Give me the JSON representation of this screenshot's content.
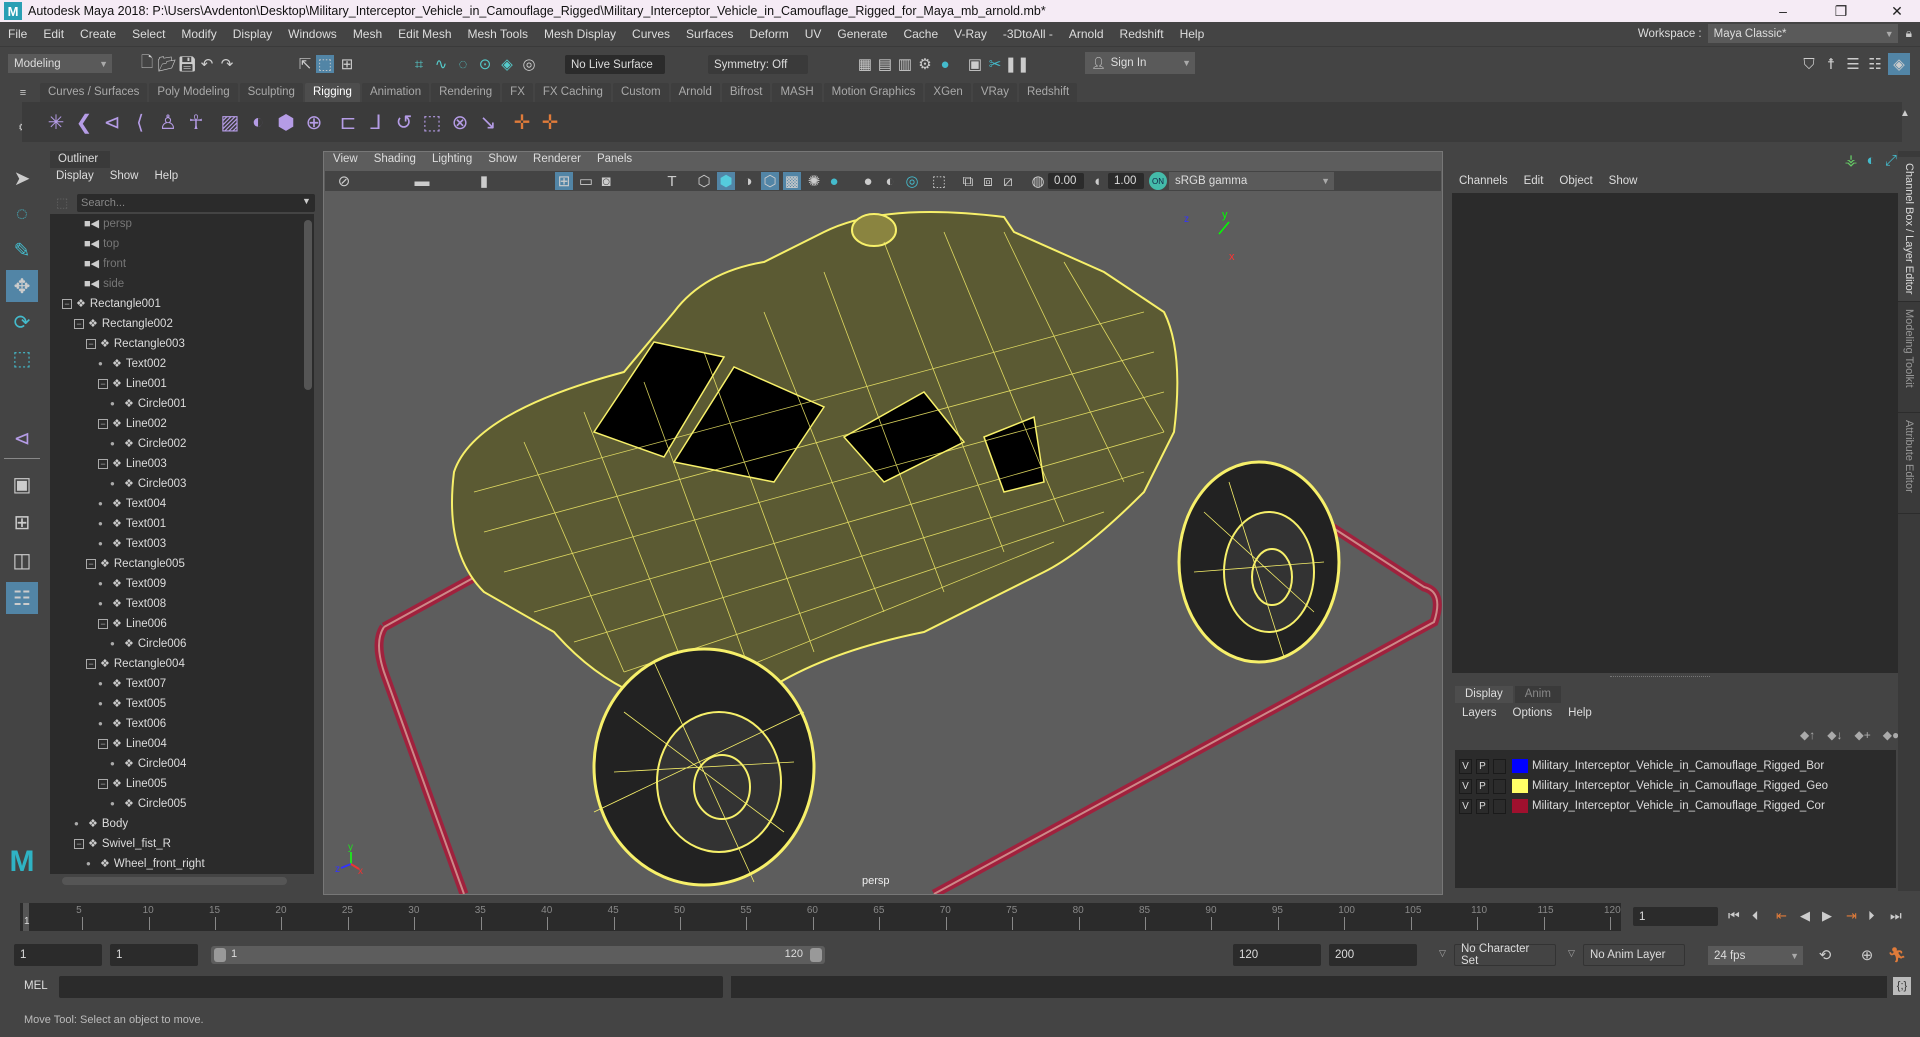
{
  "window": {
    "title": "Autodesk Maya 2018: P:\\Users\\Avdenton\\Desktop\\Military_Interceptor_Vehicle_in_Camouflage_Rigged\\Military_Interceptor_Vehicle_in_Camouflage_Rigged_for_Maya_mb_arnold.mb*",
    "logo": "M",
    "minimize": "–",
    "restore": "❐",
    "close": "✕"
  },
  "menubar": {
    "items": [
      "File",
      "Edit",
      "Create",
      "Select",
      "Modify",
      "Display",
      "Windows",
      "Mesh",
      "Edit Mesh",
      "Mesh Tools",
      "Mesh Display",
      "Curves",
      "Surfaces",
      "Deform",
      "UV",
      "Generate",
      "Cache",
      "V-Ray",
      "-3DtoAll -",
      "Arnold",
      "Redshift",
      "Help"
    ],
    "workspace_label": "Workspace :",
    "workspace_value": "Maya Classic*"
  },
  "statusline": {
    "mode": "Modeling",
    "live_surface": "No Live Surface",
    "symmetry": "Symmetry: Off",
    "sign_in": "Sign In"
  },
  "shelf": {
    "tabs": [
      "Curves / Surfaces",
      "Poly Modeling",
      "Sculpting",
      "Rigging",
      "Animation",
      "Rendering",
      "FX",
      "FX Caching",
      "Custom",
      "Arnold",
      "Bifrost",
      "MASH",
      "Motion Graphics",
      "XGen",
      "VRay",
      "Redshift"
    ],
    "active_tab": "Rigging"
  },
  "outliner": {
    "tab": "Outliner",
    "menu": [
      "Display",
      "Show",
      "Help"
    ],
    "search_placeholder": "Search...",
    "items": [
      {
        "name": "persp",
        "depth": 0,
        "type": "camera"
      },
      {
        "name": "top",
        "depth": 0,
        "type": "camera"
      },
      {
        "name": "front",
        "depth": 0,
        "type": "camera"
      },
      {
        "name": "side",
        "depth": 0,
        "type": "camera"
      },
      {
        "name": "Rectangle001",
        "depth": 0,
        "type": "group",
        "expanded": true
      },
      {
        "name": "Rectangle002",
        "depth": 1,
        "type": "group",
        "expanded": true
      },
      {
        "name": "Rectangle003",
        "depth": 2,
        "type": "group",
        "expanded": true
      },
      {
        "name": "Text002",
        "depth": 3,
        "type": "node"
      },
      {
        "name": "Line001",
        "depth": 3,
        "type": "group",
        "expanded": true
      },
      {
        "name": "Circle001",
        "depth": 4,
        "type": "node"
      },
      {
        "name": "Line002",
        "depth": 3,
        "type": "group",
        "expanded": true
      },
      {
        "name": "Circle002",
        "depth": 4,
        "type": "node"
      },
      {
        "name": "Line003",
        "depth": 3,
        "type": "group",
        "expanded": true
      },
      {
        "name": "Circle003",
        "depth": 4,
        "type": "node"
      },
      {
        "name": "Text004",
        "depth": 3,
        "type": "node"
      },
      {
        "name": "Text001",
        "depth": 3,
        "type": "node"
      },
      {
        "name": "Text003",
        "depth": 3,
        "type": "node"
      },
      {
        "name": "Rectangle005",
        "depth": 2,
        "type": "group",
        "expanded": true
      },
      {
        "name": "Text009",
        "depth": 3,
        "type": "node"
      },
      {
        "name": "Text008",
        "depth": 3,
        "type": "node"
      },
      {
        "name": "Line006",
        "depth": 3,
        "type": "group",
        "expanded": true
      },
      {
        "name": "Circle006",
        "depth": 4,
        "type": "node"
      },
      {
        "name": "Rectangle004",
        "depth": 2,
        "type": "group",
        "expanded": true
      },
      {
        "name": "Text007",
        "depth": 3,
        "type": "node"
      },
      {
        "name": "Text005",
        "depth": 3,
        "type": "node"
      },
      {
        "name": "Text006",
        "depth": 3,
        "type": "node"
      },
      {
        "name": "Line004",
        "depth": 3,
        "type": "group",
        "expanded": true
      },
      {
        "name": "Circle004",
        "depth": 4,
        "type": "node"
      },
      {
        "name": "Line005",
        "depth": 3,
        "type": "group",
        "expanded": true
      },
      {
        "name": "Circle005",
        "depth": 4,
        "type": "node"
      },
      {
        "name": "Body",
        "depth": 1,
        "type": "node"
      },
      {
        "name": "Swivel_fist_R",
        "depth": 1,
        "type": "group",
        "expanded": true
      },
      {
        "name": "Wheel_front_right",
        "depth": 2,
        "type": "node"
      }
    ]
  },
  "viewport": {
    "menu": [
      "View",
      "Shading",
      "Lighting",
      "Show",
      "Renderer",
      "Panels"
    ],
    "exposure": "0.00",
    "gamma": "1.00",
    "color_space": "sRGB gamma",
    "camera_label": "persp",
    "axis": {
      "x": "x",
      "y": "y",
      "z": "z"
    },
    "wire_color": "#f7f06a",
    "grid_color": "#a0213d"
  },
  "channel_box": {
    "menu": [
      "Channels",
      "Edit",
      "Object",
      "Show"
    ]
  },
  "side_tabs": [
    "Channel Box / Layer Editor",
    "Modeling Toolkit",
    "Attribute Editor"
  ],
  "layer_editor": {
    "tabs": [
      "Display",
      "Anim"
    ],
    "active_tab": "Display",
    "menu": [
      "Layers",
      "Options",
      "Help"
    ],
    "layers": [
      {
        "v": "V",
        "p": "P",
        "color": "#0000ff",
        "name": "Military_Interceptor_Vehicle_in_Camouflage_Rigged_Bor"
      },
      {
        "v": "V",
        "p": "P",
        "color": "#ffff66",
        "name": "Military_Interceptor_Vehicle_in_Camouflage_Rigged_Geo"
      },
      {
        "v": "V",
        "p": "P",
        "color": "#a0102e",
        "name": "Military_Interceptor_Vehicle_in_Camouflage_Rigged_Cor"
      }
    ]
  },
  "timeline": {
    "ticks": [
      "5",
      "10",
      "15",
      "20",
      "25",
      "30",
      "35",
      "40",
      "45",
      "50",
      "55",
      "60",
      "65",
      "70",
      "75",
      "80",
      "85",
      "90",
      "95",
      "100",
      "105",
      "110",
      "115",
      "120"
    ],
    "current_frame_marker": "1",
    "current_frame": "1"
  },
  "range": {
    "start": "1",
    "playback_start": "1",
    "slider_start": "1",
    "slider_end": "120",
    "playback_end": "120",
    "end": "200",
    "character_set": "No Character Set",
    "anim_layer": "No Anim Layer",
    "fps": "24 fps"
  },
  "command_line": {
    "label": "MEL"
  },
  "help_line": "Move Tool: Select an object to move."
}
